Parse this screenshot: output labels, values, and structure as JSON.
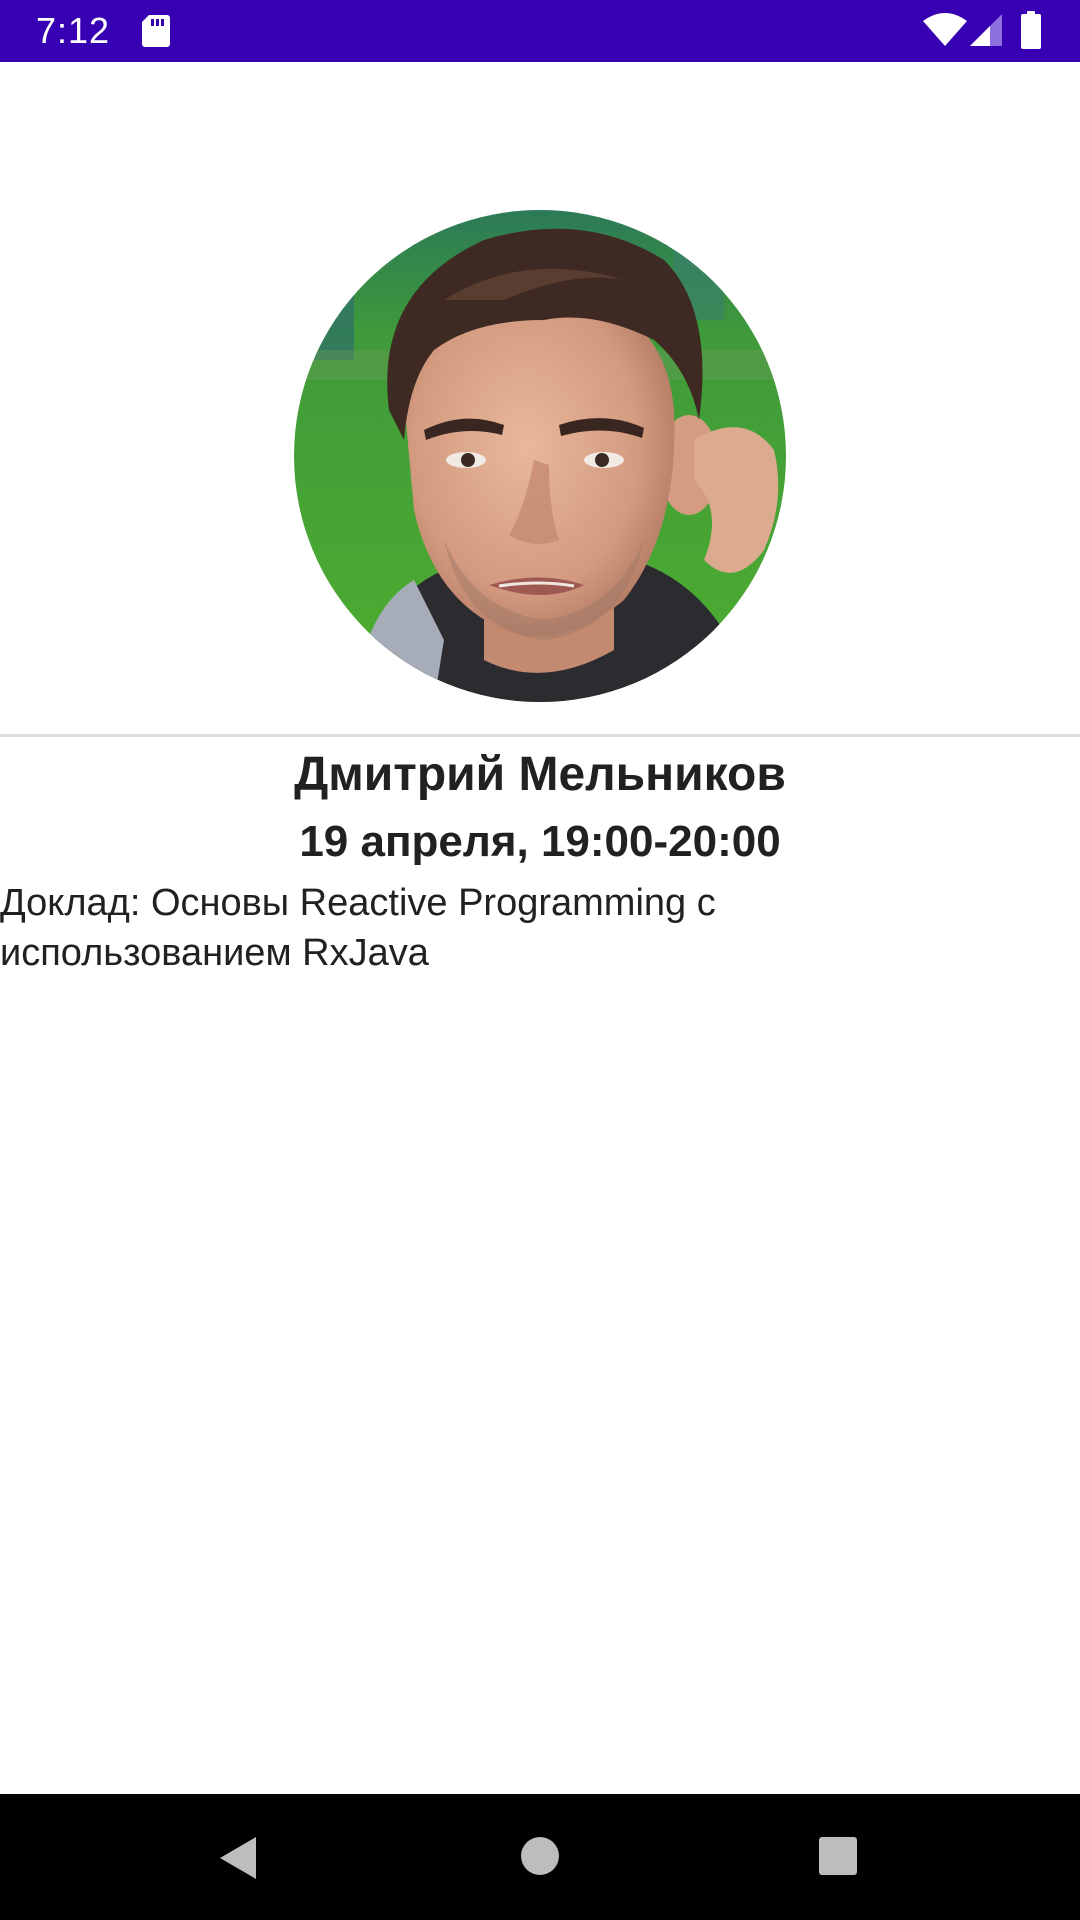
{
  "status_bar": {
    "time": "7:12",
    "background_color": "#3700b3",
    "icons": [
      "sd-card-icon",
      "wifi-icon",
      "cell-signal-icon",
      "battery-icon"
    ]
  },
  "speaker": {
    "name": "Дмитрий Мельников",
    "time": "19 апреля, 19:00-20:00",
    "talk": "Доклад: Основы Reactive Programming с использованием RxJava"
  },
  "nav_bar": {
    "icons": [
      "back-icon",
      "home-icon",
      "recents-icon"
    ]
  }
}
